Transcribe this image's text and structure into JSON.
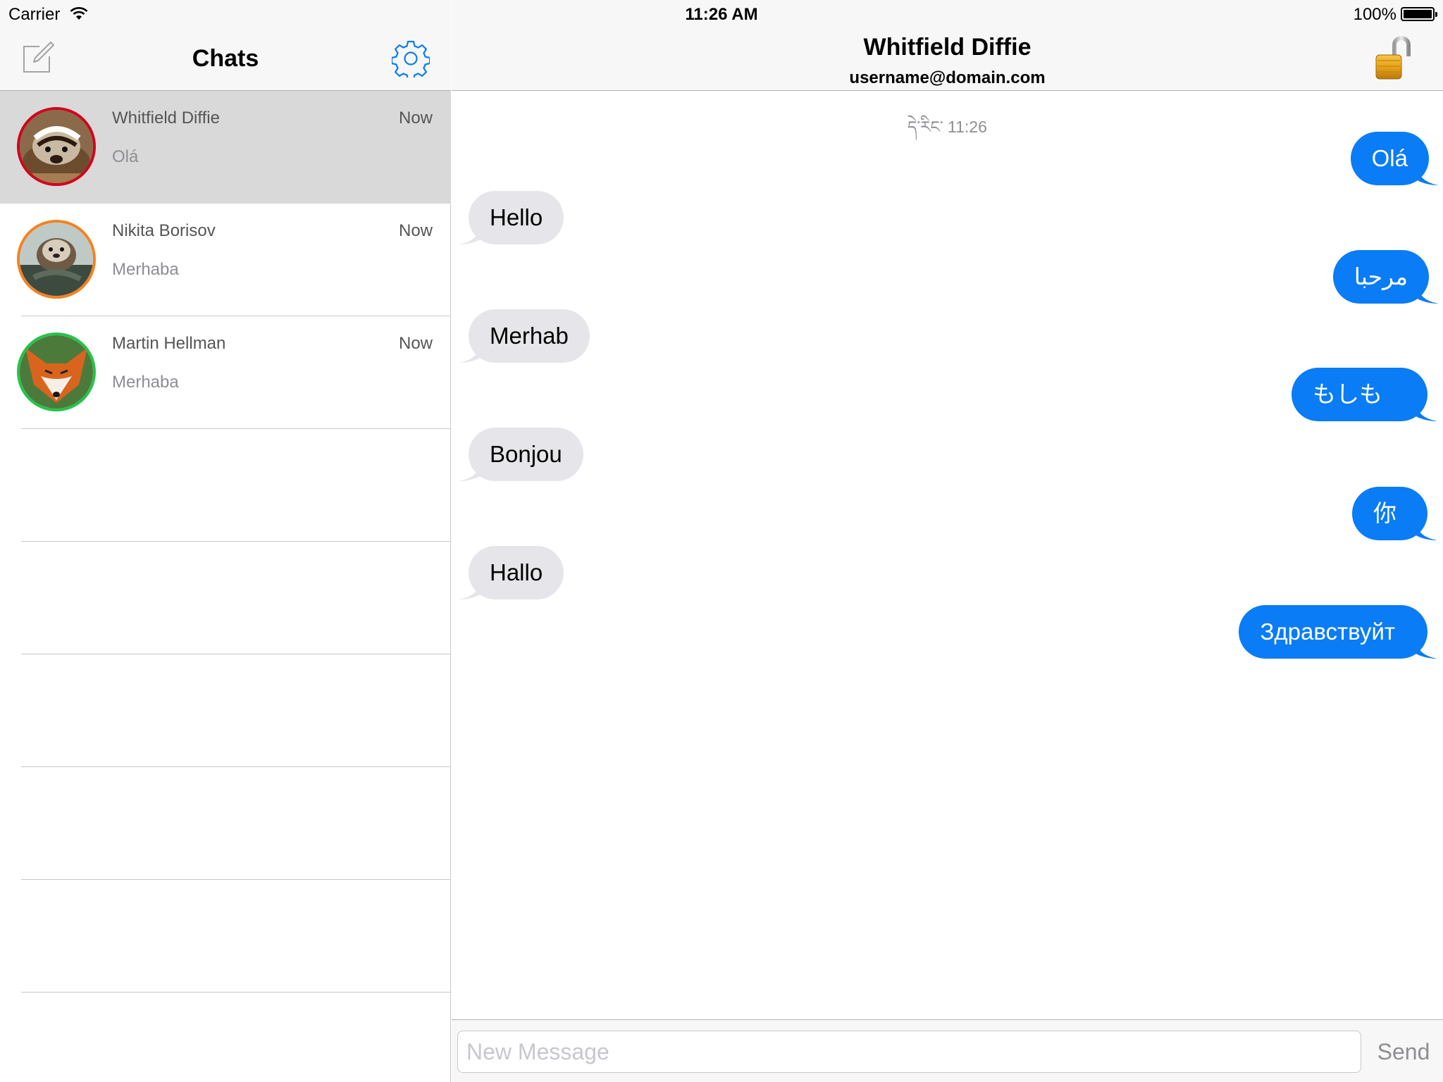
{
  "status_bar": {
    "carrier": "Carrier",
    "time": "11:26 AM",
    "battery": "100%"
  },
  "sidebar": {
    "title": "Chats",
    "chats": [
      {
        "name": "Whitfield Diffie",
        "time": "Now",
        "preview": "Olá",
        "ring_color": "#d0021b",
        "selected": true
      },
      {
        "name": "Nikita Borisov",
        "time": "Now",
        "preview": "Merhaba",
        "ring_color": "#f5821f",
        "selected": false
      },
      {
        "name": "Martin Hellman",
        "time": "Now",
        "preview": "Merhaba",
        "ring_color": "#27c24c",
        "selected": false
      }
    ]
  },
  "conversation": {
    "contact_name": "Whitfield Diffie",
    "contact_account": "username@domain.com",
    "timestamp": "དེ་རིང་ 11:26",
    "messages": [
      {
        "direction": "out",
        "text": "Olá"
      },
      {
        "direction": "in",
        "text": "Hello"
      },
      {
        "direction": "out",
        "text": "مرحبا"
      },
      {
        "direction": "in",
        "text": "Merhab"
      },
      {
        "direction": "out",
        "text": "もしも"
      },
      {
        "direction": "in",
        "text": "Bonjou"
      },
      {
        "direction": "out",
        "text": "你"
      },
      {
        "direction": "in",
        "text": "Hallo"
      },
      {
        "direction": "out",
        "text": "Здравствуйт"
      }
    ]
  },
  "composer": {
    "placeholder": "New Message",
    "value": "",
    "send_label": "Send"
  },
  "colors": {
    "accent": "#0a7cf5",
    "incoming_bubble": "#e5e5ea",
    "lock": "#e8a317"
  },
  "icons": {
    "compose": "compose-icon",
    "settings": "gear-icon",
    "lock": "unlocked-padlock-icon",
    "wifi": "wifi-icon",
    "battery": "battery-icon"
  }
}
